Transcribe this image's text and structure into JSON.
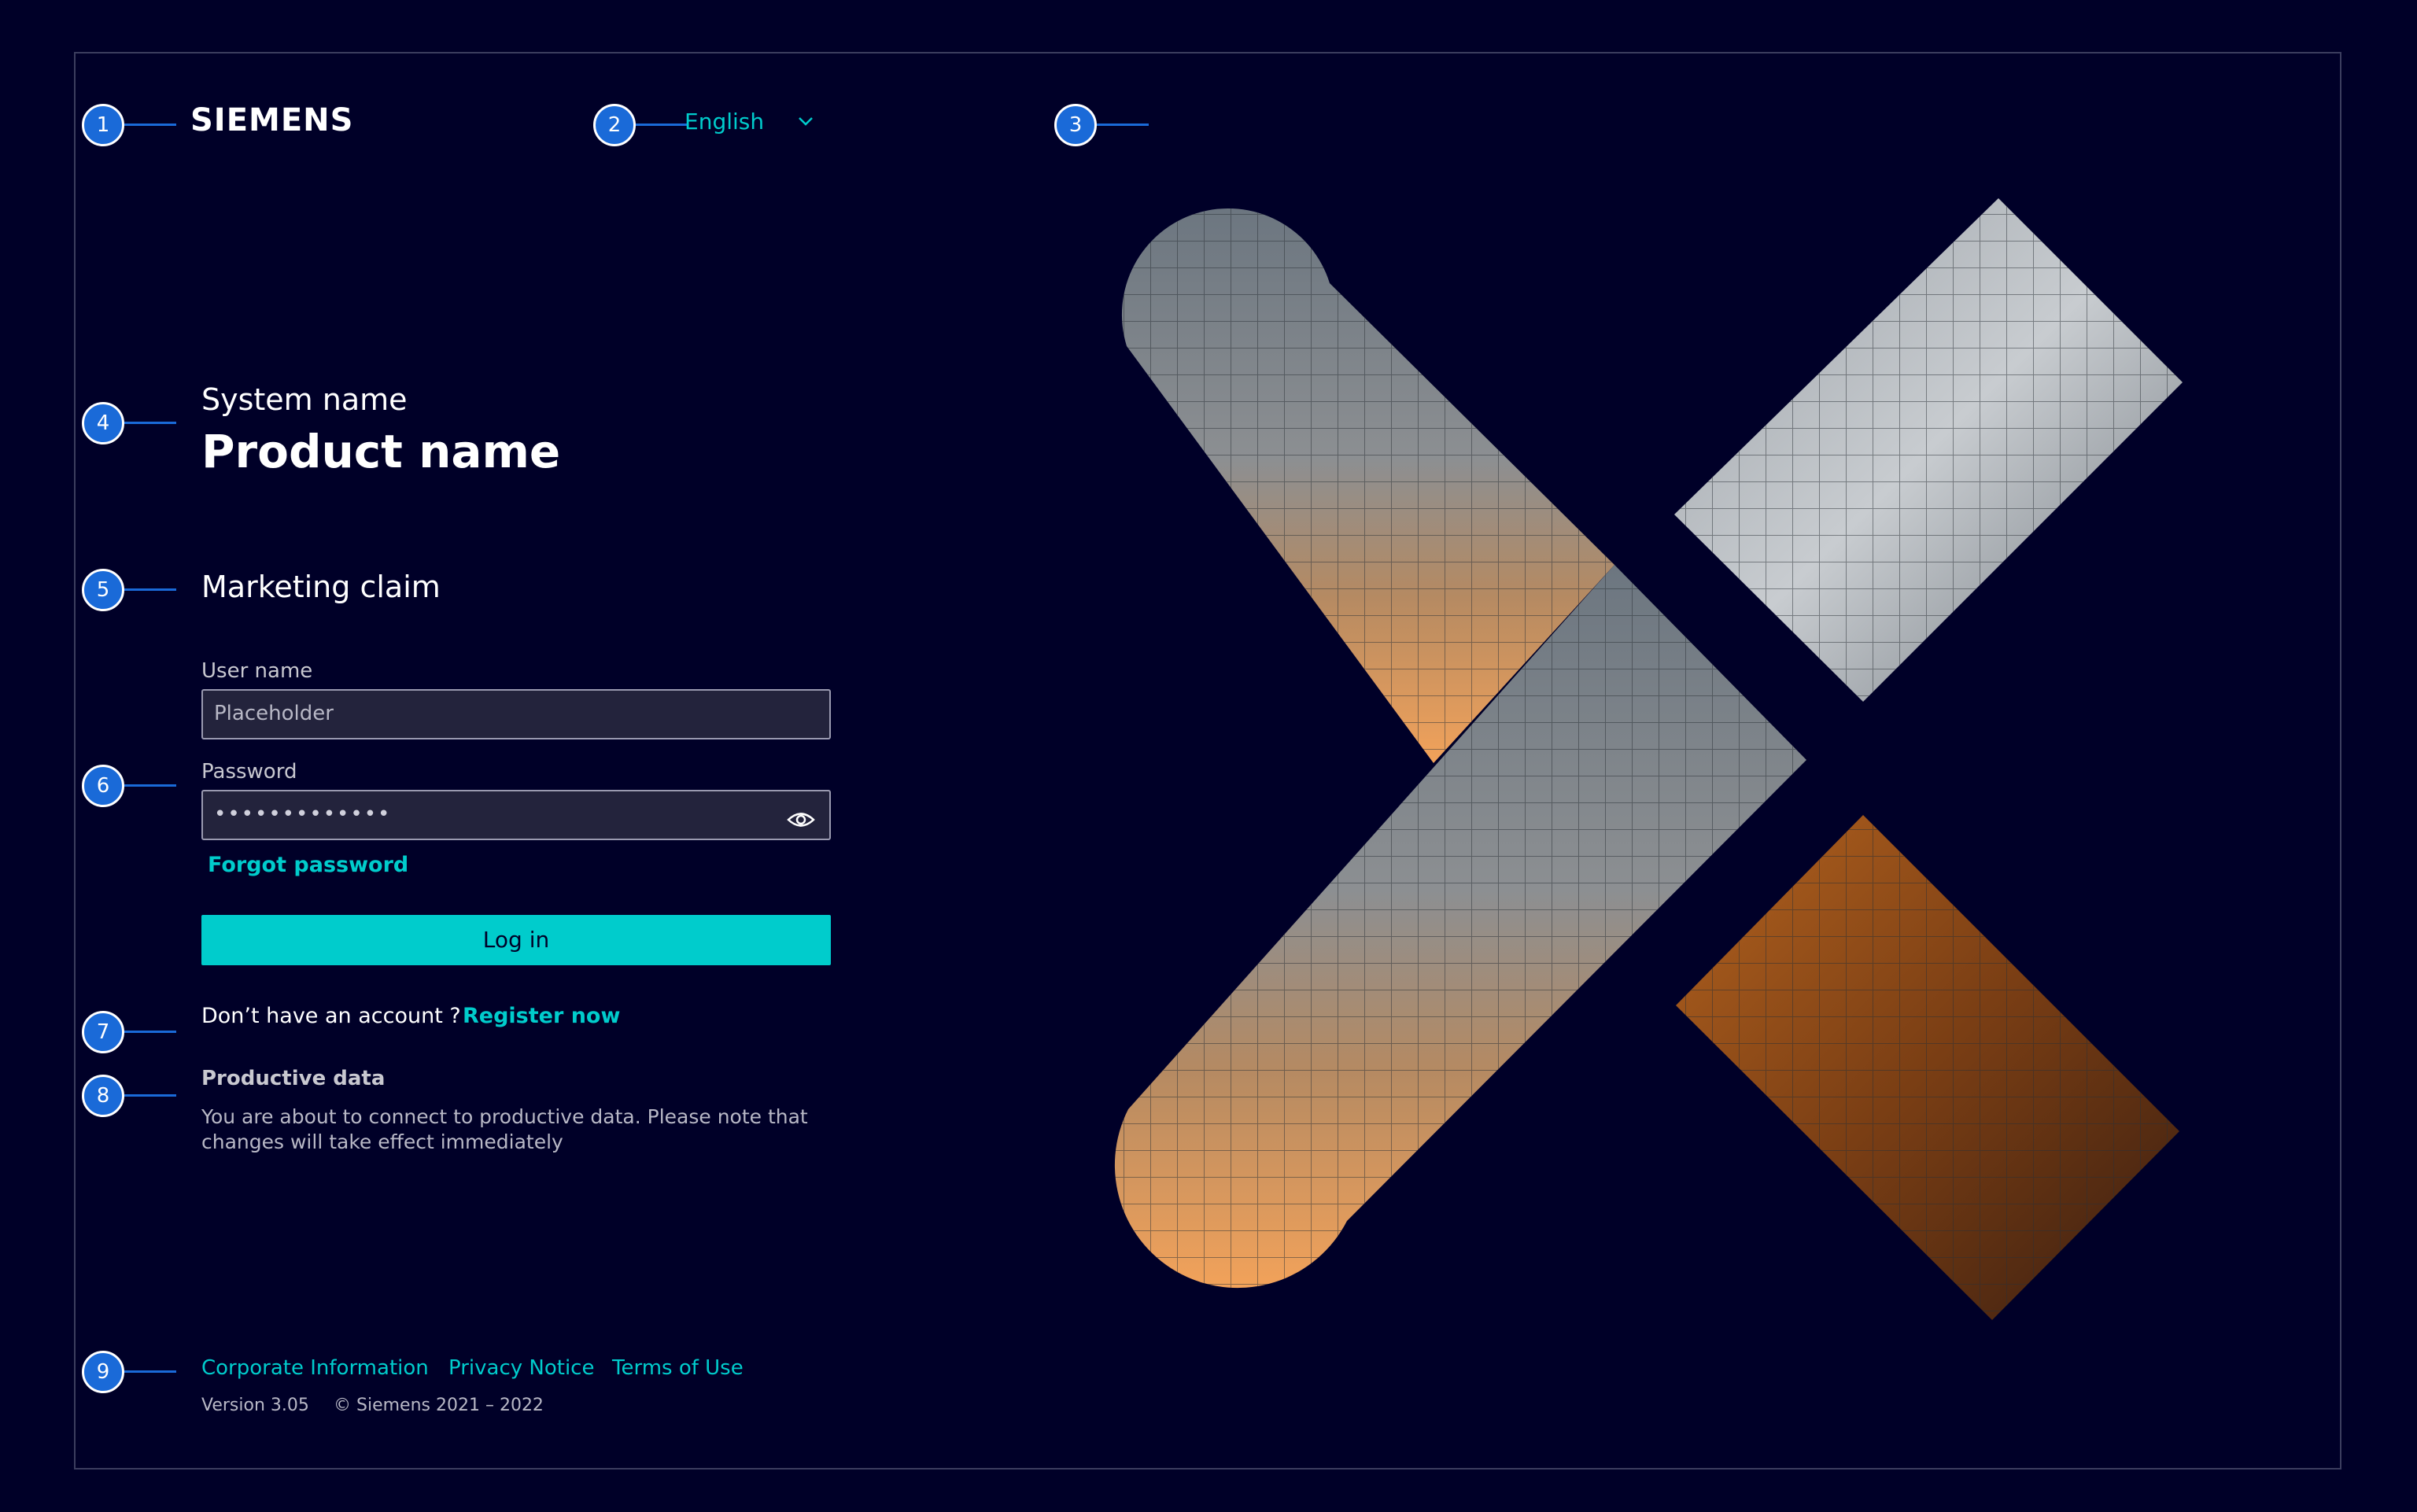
{
  "header": {
    "logo_text": "SIEMENS",
    "language": "English"
  },
  "markers": [
    "1",
    "2",
    "3",
    "4",
    "5",
    "6",
    "7",
    "8",
    "9"
  ],
  "product": {
    "system_name": "System name",
    "product_name": "Product name",
    "marketing_claim": "Marketing claim"
  },
  "form": {
    "username_label": "User name",
    "username_placeholder": "Placeholder",
    "password_label": "Password",
    "password_value": "•••••••••••••",
    "forgot_password": "Forgot password",
    "login_button": "Log in"
  },
  "register": {
    "prompt": "Don’t have an account ?",
    "link": "Register now"
  },
  "notice": {
    "title": "Productive data",
    "text_line1": "You are about to connect to productive data. Please note that",
    "text_line2": "changes will take effect immediately"
  },
  "footer": {
    "links": [
      "Corporate Information",
      "Privacy Notice",
      "Terms of Use"
    ],
    "version": "Version 3.05",
    "copyright": "© Siemens 2021 – 2022"
  },
  "colors": {
    "background": "#000028",
    "accent": "#00cccc",
    "marker": "#1a6ad8"
  },
  "icons": {
    "language_toggle": "chevron-down-icon",
    "password_toggle": "eye-icon"
  }
}
